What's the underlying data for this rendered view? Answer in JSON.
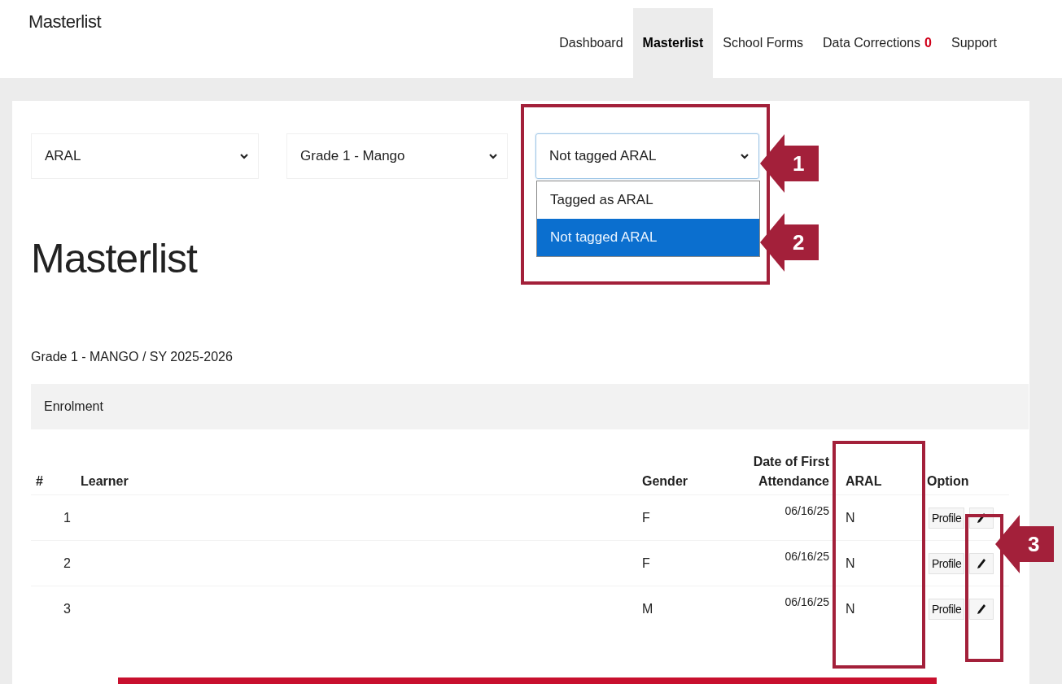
{
  "app_title": "Masterlist",
  "nav": [
    {
      "label": "Dashboard",
      "selected": false
    },
    {
      "label": "Masterlist",
      "selected": true
    },
    {
      "label": "School Forms",
      "selected": false
    },
    {
      "label": "Data Corrections",
      "selected": false,
      "badge": "0"
    },
    {
      "label": "Support",
      "selected": false
    }
  ],
  "filters": [
    {
      "value": "ARAL",
      "expanded": false
    },
    {
      "value": "Grade 1 - Mango",
      "expanded": false
    },
    {
      "value": "Not tagged ARAL",
      "expanded": true,
      "options": [
        {
          "label": "Tagged as ARAL",
          "selected": false
        },
        {
          "label": "Not tagged ARAL",
          "selected": true
        }
      ]
    }
  ],
  "heading": "Masterlist",
  "subtitle": "Grade 1 - MANGO / SY 2025-2026",
  "tabs": [
    {
      "label": "Enrolment"
    }
  ],
  "table": {
    "columns": [
      "#",
      "Learner",
      "Gender",
      "Date of First Attendance",
      "ARAL",
      "Option"
    ],
    "rows": [
      {
        "number": "1",
        "gender": "F",
        "date": "06/16/25",
        "aral": "N",
        "profile": "Profile"
      },
      {
        "number": "2",
        "gender": "F",
        "date": "06/16/25",
        "aral": "N",
        "profile": "Profile"
      },
      {
        "number": "3",
        "gender": "M",
        "date": "06/16/25",
        "aral": "N",
        "profile": "Profile"
      }
    ]
  },
  "callouts": [
    {
      "number": "1"
    },
    {
      "number": "2"
    },
    {
      "number": "3"
    }
  ]
}
